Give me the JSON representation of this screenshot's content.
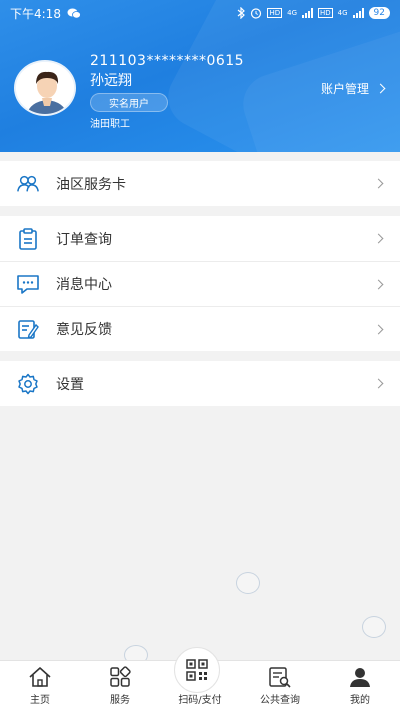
{
  "status_bar": {
    "time": "下午4:18",
    "network1": "4G",
    "network2": "4G",
    "hd1": "HD",
    "hd2": "HD",
    "battery": "92"
  },
  "profile": {
    "id_number": "211103********0615",
    "name": "孙远翔",
    "verified_badge": "实名用户",
    "category": "油田职工",
    "account_link": "账户管理"
  },
  "menu_groups": [
    [
      {
        "icon": "users-icon",
        "label": "油区服务卡"
      }
    ],
    [
      {
        "icon": "clipboard-icon",
        "label": "订单查询"
      },
      {
        "icon": "message-icon",
        "label": "消息中心"
      },
      {
        "icon": "feedback-icon",
        "label": "意见反馈"
      }
    ],
    [
      {
        "icon": "gear-icon",
        "label": "设置"
      }
    ]
  ],
  "tabbar": {
    "home": "主页",
    "services": "服务",
    "scan": "扫码/支付",
    "public_query": "公共查询",
    "mine": "我的"
  },
  "colors": {
    "header": "#2a86e6",
    "icon": "#1a76c6",
    "background": "#f2f2f2"
  }
}
